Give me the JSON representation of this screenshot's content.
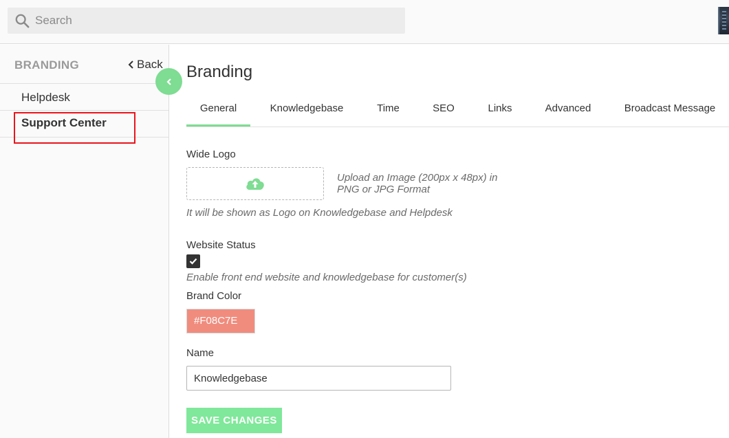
{
  "search": {
    "placeholder": "Search"
  },
  "sidebar": {
    "title": "BRANDING",
    "back_label": "Back",
    "items": [
      {
        "label": "Helpdesk"
      },
      {
        "label": "Support Center"
      }
    ]
  },
  "main": {
    "title": "Branding",
    "tabs": [
      {
        "label": "General"
      },
      {
        "label": "Knowledgebase"
      },
      {
        "label": "Time"
      },
      {
        "label": "SEO"
      },
      {
        "label": "Links"
      },
      {
        "label": "Advanced"
      },
      {
        "label": "Broadcast Message"
      }
    ],
    "wide_logo": {
      "label": "Wide Logo",
      "upload_hint_line1": "Upload an Image (200px x 48px) in",
      "upload_hint_line2": "PNG or JPG Format",
      "description": "It will be shown as Logo on Knowledgebase and Helpdesk"
    },
    "website_status": {
      "label": "Website Status",
      "checked": true,
      "description": "Enable front end website and knowledgebase for customer(s)"
    },
    "brand_color": {
      "label": "Brand Color",
      "value": "#F08C7E"
    },
    "name": {
      "label": "Name",
      "value": "Knowledgebase"
    },
    "save_label": "SAVE CHANGES"
  },
  "colors": {
    "accent": "#7fdc93",
    "brand_color": "#F08C7E",
    "highlight": "#e8141b"
  },
  "icons": {
    "search": "search-icon",
    "back": "chevron-left-icon",
    "collapse": "chevron-left-icon",
    "upload": "cloud-upload-icon",
    "check": "checkmark-icon"
  }
}
